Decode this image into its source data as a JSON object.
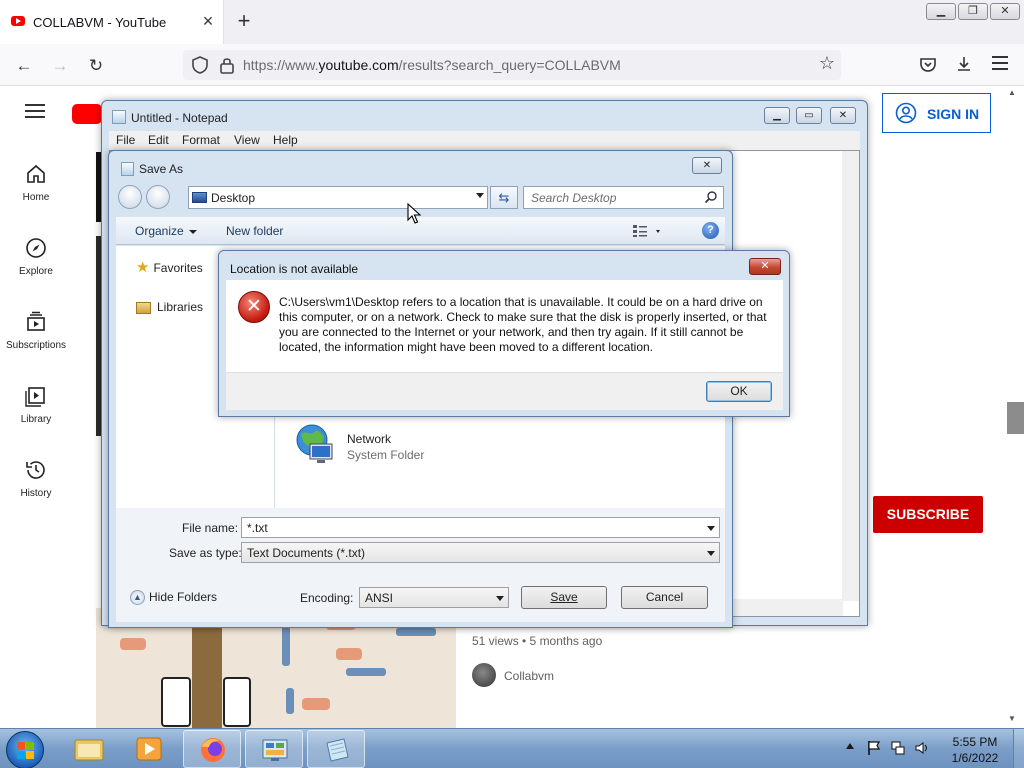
{
  "browser": {
    "tab_title": "COLLABVM - YouTube",
    "url_prefix": "https://www.",
    "url_domain": "youtube.com",
    "url_path": "/results?search_query=COLLABVM"
  },
  "youtube": {
    "nav": [
      {
        "label": "Home",
        "icon": "home-icon"
      },
      {
        "label": "Explore",
        "icon": "compass-icon"
      },
      {
        "label": "Subscriptions",
        "icon": "subscriptions-icon"
      },
      {
        "label": "Library",
        "icon": "library-icon"
      },
      {
        "label": "History",
        "icon": "history-icon"
      }
    ],
    "sign_in": "SIGN IN",
    "subscribe": "SUBSCRIBE",
    "video_meta": "51 views • 5 months ago",
    "channel": "Collabvm",
    "brand_color": "#ff0000",
    "subscribe_color": "#cc0000",
    "signin_color": "#065fd4"
  },
  "notepad": {
    "title": "Untitled - Notepad",
    "menu": [
      "File",
      "Edit",
      "Format",
      "View",
      "Help"
    ]
  },
  "save_as": {
    "title": "Save As",
    "location": "Desktop",
    "search_placeholder": "Search Desktop",
    "toolbar": {
      "organize": "Organize",
      "new_folder": "New folder"
    },
    "nav_items": [
      "Favorites",
      "Libraries"
    ],
    "network_name": "Network",
    "network_type": "System Folder",
    "file_name_label": "File name:",
    "file_name_value": "*.txt",
    "save_type_label": "Save as type:",
    "save_type_value": "Text Documents (*.txt)",
    "hide_folders": "Hide Folders",
    "encoding_label": "Encoding:",
    "encoding_value": "ANSI",
    "save_button": "Save",
    "cancel_button": "Cancel"
  },
  "error_dialog": {
    "title": "Location is not available",
    "message": "C:\\Users\\vm1\\Desktop refers to a location that is unavailable. It could be on a hard drive on this computer, or on a network. Check to make sure that the disk is properly inserted, or that you are connected to the Internet or your network, and then try again. If it still cannot be located, the information might have been moved to a different location.",
    "ok": "OK",
    "icon": "error-icon"
  },
  "taskbar": {
    "time": "5:55 PM",
    "date": "1/6/2022"
  }
}
